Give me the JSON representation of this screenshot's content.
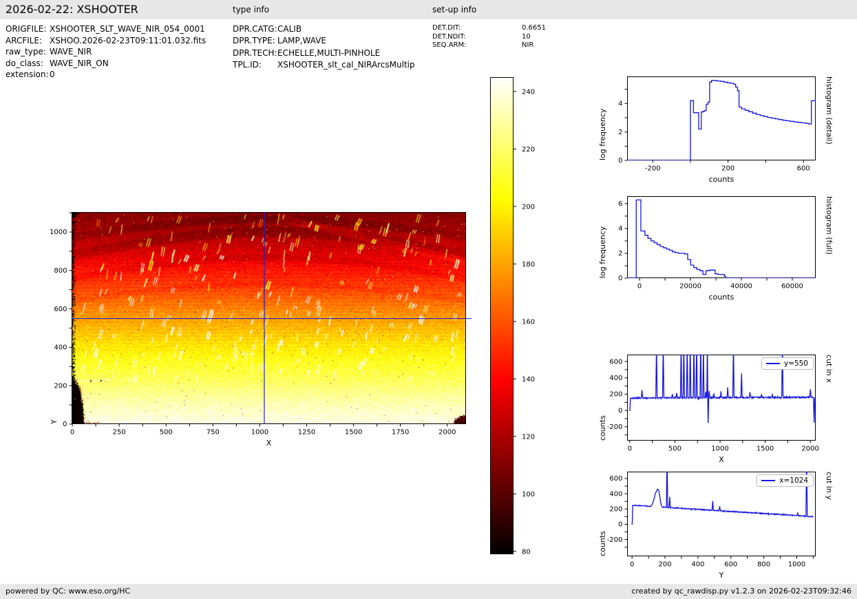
{
  "header": {
    "title": "2026-02-22: XSHOOTER",
    "sections": {
      "type_info": "type info",
      "setup_info": "set-up info"
    },
    "file_info": [
      {
        "label": "ORIGFILE:",
        "value": "XSHOOTER_SLT_WAVE_NIR_054_0001"
      },
      {
        "label": "ARCFILE:",
        "value": "XSHOO.2026-02-23T09:11:01.032.fits"
      },
      {
        "label": "raw_type:",
        "value": "WAVE_NIR"
      },
      {
        "label": "do_class:",
        "value": "WAVE_NIR_ON"
      },
      {
        "label": "extension:",
        "value": "0"
      }
    ],
    "type_info": [
      {
        "label": "DPR.CATG:",
        "value": "CALIB"
      },
      {
        "label": "DPR.TYPE:",
        "value": "LAMP,WAVE"
      },
      {
        "label": "DPR.TECH:",
        "value": "ECHELLE,MULTI-PINHOLE"
      },
      {
        "label": "TPL.ID:",
        "value": "XSHOOTER_slt_cal_NIRArcsMultip"
      }
    ],
    "setup_info": [
      {
        "label": "DET.DIT:",
        "value": "0.6651"
      },
      {
        "label": "DET.NDIT:",
        "value": "10"
      },
      {
        "label": "SEQ.ARM:",
        "value": "NIR"
      }
    ]
  },
  "footer": {
    "left": "powered by QC: www.eso.org/HC",
    "right": "created by qc_rawdisp.py v1.2.3 on 2026-02-23T09:32:46"
  },
  "colors": {
    "line_blue": "#1414e0",
    "crosshair_blue": "#2222cc",
    "bar_bg": "#e8e8e8"
  },
  "colorbar": {
    "vmin": 79,
    "vmax": 245,
    "colormap": "hot",
    "ticks": [
      {
        "v": 240,
        "l": "240"
      },
      {
        "v": 220,
        "l": "220"
      },
      {
        "v": 200,
        "l": "200"
      },
      {
        "v": 180,
        "l": "180"
      },
      {
        "v": 160,
        "l": "160"
      },
      {
        "v": 140,
        "l": "140"
      },
      {
        "v": 120,
        "l": "120"
      },
      {
        "v": 100,
        "l": "100"
      },
      {
        "v": 80,
        "l": "80"
      }
    ]
  },
  "chart_data": [
    {
      "id": "histogram-detail",
      "type": "line",
      "line_style": "step",
      "xlabel": "counts",
      "ylabel": "log frequency",
      "right_label": "histogram (detail)",
      "xlim": [
        -336,
        665
      ],
      "ylim": [
        0,
        5.9
      ],
      "xticks": [
        {
          "v": -200,
          "l": "-200"
        },
        {
          "v": 0
        },
        {
          "v": 200,
          "l": "200"
        },
        {
          "v": 400
        },
        {
          "v": 600,
          "l": "600"
        }
      ],
      "yticks": [
        {
          "v": 0,
          "l": "0"
        },
        {
          "v": 1
        },
        {
          "v": 2,
          "l": "2"
        },
        {
          "v": 3
        },
        {
          "v": 4,
          "l": "4"
        },
        {
          "v": 5
        }
      ],
      "steps": [
        [
          0,
          4.2
        ],
        [
          16,
          3.35
        ],
        [
          44,
          2.2
        ],
        [
          58,
          3.4
        ],
        [
          66,
          3.45
        ],
        [
          76,
          3.5
        ],
        [
          84,
          3.95
        ],
        [
          94,
          4.1
        ],
        [
          102,
          5.5
        ],
        [
          112,
          5.62
        ],
        [
          140,
          5.58
        ],
        [
          160,
          5.55
        ],
        [
          178,
          5.5
        ],
        [
          196,
          5.45
        ],
        [
          214,
          5.42
        ],
        [
          230,
          5.35
        ],
        [
          240,
          5.15
        ],
        [
          250,
          4.9
        ],
        [
          258,
          3.75
        ],
        [
          272,
          3.62
        ],
        [
          290,
          3.52
        ],
        [
          310,
          3.42
        ],
        [
          330,
          3.32
        ],
        [
          350,
          3.22
        ],
        [
          370,
          3.15
        ],
        [
          390,
          3.08
        ],
        [
          410,
          3.02
        ],
        [
          430,
          2.97
        ],
        [
          450,
          2.92
        ],
        [
          470,
          2.87
        ],
        [
          490,
          2.82
        ],
        [
          510,
          2.78
        ],
        [
          530,
          2.74
        ],
        [
          550,
          2.7
        ],
        [
          570,
          2.67
        ],
        [
          590,
          2.64
        ],
        [
          610,
          2.6
        ],
        [
          628,
          2.56
        ],
        [
          642,
          4.2
        ]
      ]
    },
    {
      "id": "histogram-full",
      "type": "line",
      "line_style": "step",
      "xlabel": "counts",
      "ylabel": "log frequency",
      "right_label": "histogram (full)",
      "xlim": [
        -4900,
        69200
      ],
      "ylim": [
        0,
        6.6
      ],
      "xticks": [
        {
          "v": 0,
          "l": "0"
        },
        {
          "v": 10000
        },
        {
          "v": 20000,
          "l": "20000"
        },
        {
          "v": 30000
        },
        {
          "v": 40000,
          "l": "40000"
        },
        {
          "v": 50000
        },
        {
          "v": 60000,
          "l": "60000"
        }
      ],
      "yticks": [
        {
          "v": 0,
          "l": "0"
        },
        {
          "v": 1
        },
        {
          "v": 2,
          "l": "2"
        },
        {
          "v": 3
        },
        {
          "v": 4,
          "l": "4"
        },
        {
          "v": 5
        },
        {
          "v": 6,
          "l": "6"
        }
      ],
      "steps": [
        [
          -1300,
          6.3
        ],
        [
          500,
          3.8
        ],
        [
          2100,
          3.45
        ],
        [
          3300,
          3.2
        ],
        [
          4500,
          3.0
        ],
        [
          5700,
          2.85
        ],
        [
          6900,
          2.7
        ],
        [
          8100,
          2.55
        ],
        [
          9300,
          2.45
        ],
        [
          10500,
          2.35
        ],
        [
          11700,
          2.25
        ],
        [
          12900,
          2.12
        ],
        [
          14100,
          2.05
        ],
        [
          15300,
          2.0
        ],
        [
          16500,
          2.0
        ],
        [
          17700,
          1.95
        ],
        [
          18900,
          1.5
        ],
        [
          20100,
          1.05
        ],
        [
          21300,
          0.85
        ],
        [
          22500,
          0.7
        ],
        [
          23700,
          0.6
        ],
        [
          24900,
          0.3
        ],
        [
          26100,
          0.6
        ],
        [
          27300,
          0.65
        ],
        [
          28500,
          0.65
        ],
        [
          29700,
          0.35
        ],
        [
          30900,
          0.3
        ],
        [
          32100,
          0.3
        ],
        [
          33300,
          0.15
        ],
        [
          33900,
          0
        ]
      ]
    },
    {
      "id": "cut-in-x",
      "type": "line",
      "line_style": "noisy",
      "legend": "y=550",
      "xlabel": "X",
      "ylabel": "counts",
      "right_label": "cut in x",
      "xlim": [
        -30,
        2060
      ],
      "ylim": [
        -370,
        685
      ],
      "xticks": [
        {
          "v": 0,
          "l": "0"
        },
        {
          "v": 250
        },
        {
          "v": 500,
          "l": "500"
        },
        {
          "v": 750
        },
        {
          "v": 1000,
          "l": "1000"
        },
        {
          "v": 1250
        },
        {
          "v": 1500,
          "l": "1500"
        },
        {
          "v": 1750
        },
        {
          "v": 2000,
          "l": "2000"
        }
      ],
      "yticks": [
        {
          "v": -300
        },
        {
          "v": -200,
          "l": "-200"
        },
        {
          "v": -100
        },
        {
          "v": 0,
          "l": "0"
        },
        {
          "v": 100
        },
        {
          "v": 200,
          "l": "200"
        },
        {
          "v": 300
        },
        {
          "v": 400,
          "l": "400"
        },
        {
          "v": 500
        },
        {
          "v": 600,
          "l": "600"
        }
      ],
      "baseline": {
        "x0": 0,
        "x1": 2050,
        "y0": 152,
        "y1": 162,
        "noise": 8
      },
      "bumps": [],
      "spikes": [
        [
          135,
          250
        ],
        [
          295,
          820
        ],
        [
          370,
          820
        ],
        [
          470,
          200
        ],
        [
          520,
          215
        ],
        [
          570,
          820
        ],
        [
          600,
          820
        ],
        [
          635,
          820
        ],
        [
          670,
          820
        ],
        [
          710,
          820
        ],
        [
          740,
          820
        ],
        [
          785,
          820
        ],
        [
          815,
          820
        ],
        [
          840,
          230
        ],
        [
          862,
          820
        ],
        [
          880,
          240
        ],
        [
          930,
          210
        ],
        [
          1010,
          235
        ],
        [
          1085,
          285
        ],
        [
          1150,
          820
        ],
        [
          1240,
          455
        ],
        [
          1330,
          225
        ],
        [
          1460,
          200
        ],
        [
          1580,
          195
        ],
        [
          1690,
          820
        ],
        [
          2000,
          260
        ]
      ],
      "dips": [
        [
          868,
          -155
        ],
        [
          2046,
          -150
        ]
      ],
      "seed": 101
    },
    {
      "id": "cut-in-y",
      "type": "line",
      "line_style": "noisy",
      "legend": "x=1024",
      "xlabel": "Y",
      "ylabel": "counts",
      "right_label": "cut in y",
      "xlim": [
        -30,
        1115
      ],
      "ylim": [
        -420,
        690
      ],
      "xticks": [
        {
          "v": 0,
          "l": "0"
        },
        {
          "v": 100
        },
        {
          "v": 200,
          "l": "200"
        },
        {
          "v": 300
        },
        {
          "v": 400,
          "l": "400"
        },
        {
          "v": 500
        },
        {
          "v": 600,
          "l": "600"
        },
        {
          "v": 700
        },
        {
          "v": 800,
          "l": "800"
        },
        {
          "v": 900
        },
        {
          "v": 1000,
          "l": "1000"
        },
        {
          "v": 1100
        }
      ],
      "yticks": [
        {
          "v": -300
        },
        {
          "v": -200,
          "l": "-200"
        },
        {
          "v": -100
        },
        {
          "v": 0,
          "l": "0"
        },
        {
          "v": 100
        },
        {
          "v": 200,
          "l": "200"
        },
        {
          "v": 300
        },
        {
          "v": 400,
          "l": "400"
        },
        {
          "v": 500
        },
        {
          "v": 600,
          "l": "600"
        }
      ],
      "baseline": {
        "x0": 0,
        "x1": 1100,
        "y0": 250,
        "y1": 100,
        "noise": 6
      },
      "bumps": [
        [
          148,
          190,
          13
        ],
        [
          163,
          110,
          7
        ]
      ],
      "spikes": [
        [
          213,
          900
        ],
        [
          228,
          360
        ],
        [
          490,
          305
        ],
        [
          532,
          235
        ],
        [
          1005,
          155
        ],
        [
          1060,
          900
        ]
      ],
      "dips": [],
      "seed": 202
    },
    {
      "id": "raw-image",
      "type": "heatmap",
      "colormap": "hot",
      "xlabel": "X",
      "ylabel": "Y",
      "xlim": [
        -4,
        2100
      ],
      "ylim": [
        0,
        1104
      ],
      "xticks": [
        {
          "v": 0,
          "l": "0"
        },
        {
          "v": 125
        },
        {
          "v": 250,
          "l": "250"
        },
        {
          "v": 375
        },
        {
          "v": 500,
          "l": "500"
        },
        {
          "v": 625
        },
        {
          "v": 750,
          "l": "750"
        },
        {
          "v": 875
        },
        {
          "v": 1000,
          "l": "1000"
        },
        {
          "v": 1125
        },
        {
          "v": 1250,
          "l": "1250"
        },
        {
          "v": 1375
        },
        {
          "v": 1500,
          "l": "1500"
        },
        {
          "v": 1625
        },
        {
          "v": 1750,
          "l": "1750"
        },
        {
          "v": 1875
        },
        {
          "v": 2000,
          "l": "2000"
        }
      ],
      "yticks": [
        {
          "v": 0,
          "l": "0"
        },
        {
          "v": 100
        },
        {
          "v": 200,
          "l": "200"
        },
        {
          "v": 300
        },
        {
          "v": 400,
          "l": "400"
        },
        {
          "v": 500
        },
        {
          "v": 600,
          "l": "600"
        },
        {
          "v": 700
        },
        {
          "v": 800,
          "l": "800"
        },
        {
          "v": 900
        },
        {
          "v": 1000,
          "l": "1000"
        },
        {
          "v": 1100
        }
      ],
      "crosshair": {
        "x": 1024,
        "y": 550
      },
      "value_profile": [
        [
          0,
          242
        ],
        [
          120,
          231
        ],
        [
          220,
          219
        ],
        [
          320,
          208
        ],
        [
          420,
          196
        ],
        [
          520,
          183
        ],
        [
          600,
          172
        ],
        [
          700,
          157
        ],
        [
          800,
          144
        ],
        [
          900,
          130
        ],
        [
          1000,
          119
        ],
        [
          1104,
          110
        ]
      ]
    }
  ]
}
